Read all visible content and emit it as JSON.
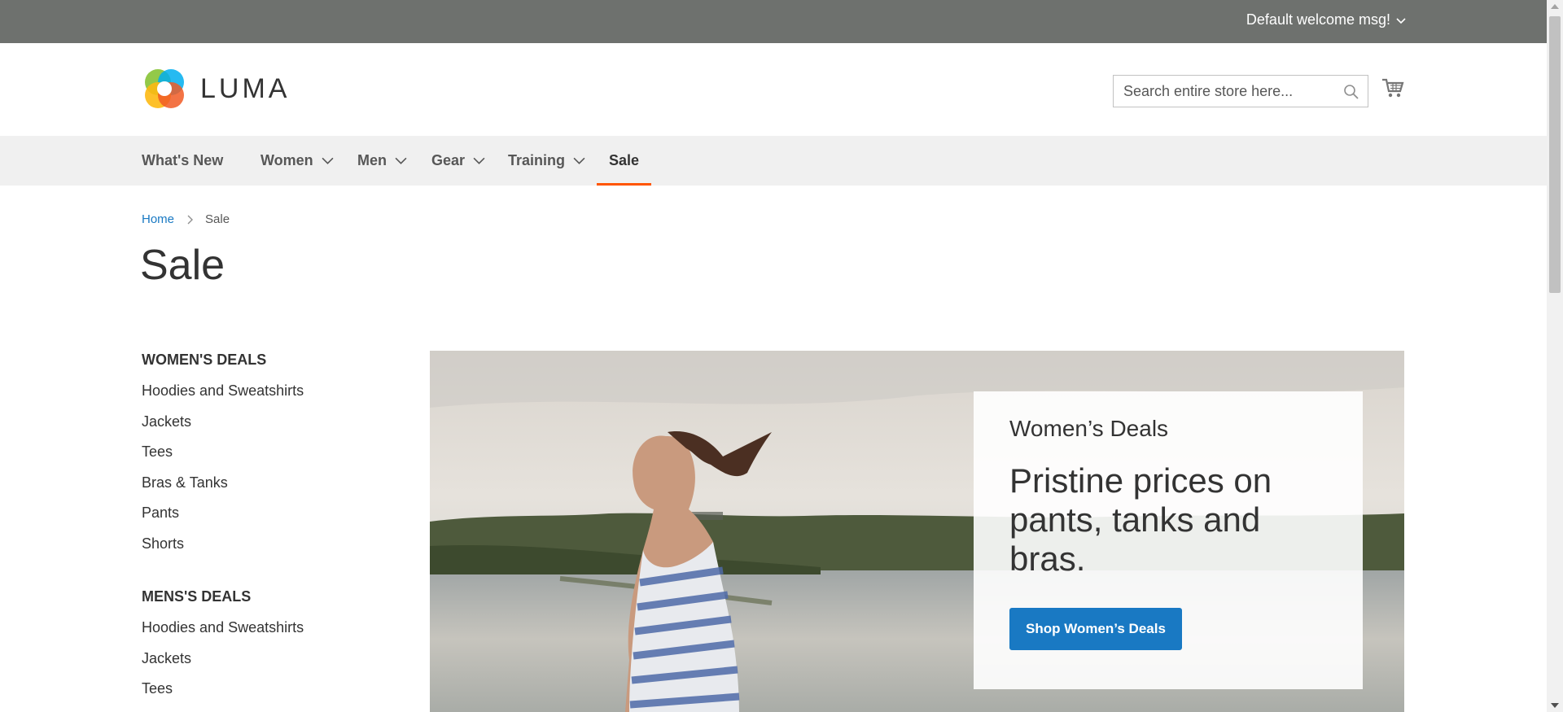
{
  "topbar": {
    "welcome": "Default welcome msg!",
    "color": "#6e716e"
  },
  "header": {
    "logo_text": "LUMA",
    "search_placeholder": "Search entire store here..."
  },
  "nav": {
    "items": [
      {
        "label": "What's New",
        "has_dropdown": false
      },
      {
        "label": "Women",
        "has_dropdown": true
      },
      {
        "label": "Men",
        "has_dropdown": true
      },
      {
        "label": "Gear",
        "has_dropdown": true
      },
      {
        "label": "Training",
        "has_dropdown": true
      },
      {
        "label": "Sale",
        "has_dropdown": false,
        "active": true
      }
    ],
    "active_color": "#ff5501"
  },
  "breadcrumb": {
    "home": "Home",
    "current": "Sale"
  },
  "page_title": "Sale",
  "sidebar": {
    "womens": {
      "heading": "WOMEN'S DEALS",
      "links": [
        "Hoodies and Sweatshirts",
        "Jackets",
        "Tees",
        "Bras & Tanks",
        "Pants",
        "Shorts"
      ]
    },
    "mens": {
      "heading": "MENS'S DEALS",
      "links": [
        "Hoodies and Sweatshirts",
        "Jackets",
        "Tees"
      ]
    }
  },
  "banner": {
    "kicker": "Women’s Deals",
    "headline": "Pristine prices on pants, tanks and bras.",
    "button": "Shop Women’s Deals",
    "button_color": "#1979c3"
  }
}
